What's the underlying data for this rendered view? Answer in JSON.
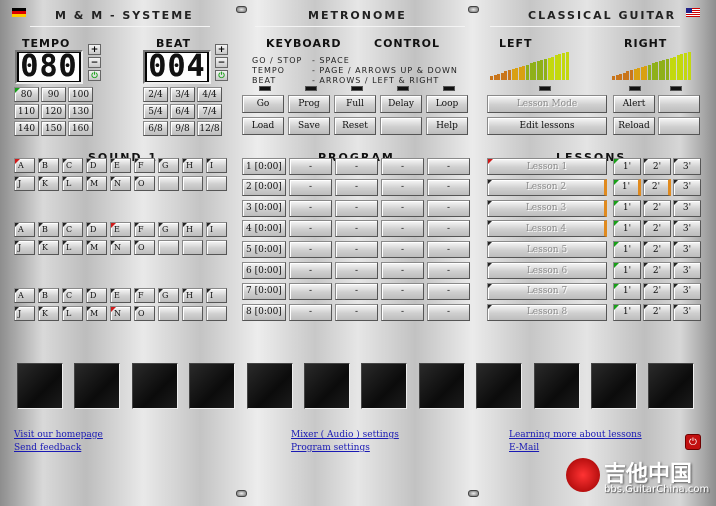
{
  "header": {
    "brand": "M & M - Systeme",
    "center": "Metronome",
    "right": "Classical Guitar"
  },
  "tempo": {
    "label": "Tempo",
    "display": "080",
    "presets": [
      "80",
      "90",
      "100",
      "110",
      "120",
      "130",
      "140",
      "150",
      "160"
    ]
  },
  "beat": {
    "label": "Beat",
    "display": "004",
    "presets": [
      "2/4",
      "3/4",
      "4/4",
      "5/4",
      "6/4",
      "7/4",
      "6/8",
      "9/8",
      "12/8"
    ]
  },
  "stepper": {
    "plus": "+",
    "minus": "−",
    "reset": "⏻"
  },
  "keyboard": {
    "label_keyboard": "Keyboard",
    "label_control": "Control",
    "lines": [
      {
        "key": "GO / STOP",
        "value": "- SPACE"
      },
      {
        "key": "TEMPO",
        "value": "- PAGE / ARROWS UP & DOWN"
      },
      {
        "key": "BEAT",
        "value": "- ARROWS / LEFT & RIGHT"
      }
    ]
  },
  "controls": {
    "row1": [
      "Go",
      "Prog",
      "Full",
      "Delay",
      "Loop"
    ],
    "row2": [
      "Load",
      "Save",
      "Reset",
      "",
      "Help"
    ]
  },
  "meters": {
    "left": "Left",
    "right": "Right"
  },
  "lesson_ctrl": {
    "mode": "Lesson Mode",
    "alert": "Alert",
    "edit": "Edit lessons",
    "reload": "Reload"
  },
  "sound": {
    "label": "Sound 1",
    "row1": [
      "A",
      "B",
      "C",
      "D",
      "E",
      "F",
      "G",
      "H",
      "I"
    ],
    "row2": [
      "J",
      "K",
      "L",
      "M",
      "N",
      "O",
      "",
      "",
      ""
    ]
  },
  "program": {
    "label": "Program",
    "rows": [
      "1 [0:00]",
      "2 [0:00]",
      "3 [0:00]",
      "4 [0:00]",
      "5 [0:00]",
      "6 [0:00]",
      "7 [0:00]",
      "8 [0:00]"
    ],
    "dash": "-"
  },
  "lessons": {
    "label": "Lessons",
    "items": [
      "Lesson 1",
      "Lesson 2",
      "Lesson 3",
      "Lesson 4",
      "Lesson 5",
      "Lesson 6",
      "Lesson 7",
      "Lesson 8"
    ],
    "times": [
      "1'",
      "2'",
      "3'"
    ]
  },
  "links": {
    "homepage": "Visit our homepage",
    "feedback": "Send feedback",
    "mixer": "Mixer ( Audio ) settings",
    "program_settings": "Program settings",
    "learning": "Learning more about lessons ",
    "email": "E-Mail"
  },
  "watermark": {
    "cn": "吉他中国",
    "url": "bbs.GuitarChina.com"
  },
  "colors": {
    "accent_orange": "#e08a1e",
    "marker_red": "#d01818",
    "marker_green": "#18a018",
    "link": "#1a1ab4"
  }
}
